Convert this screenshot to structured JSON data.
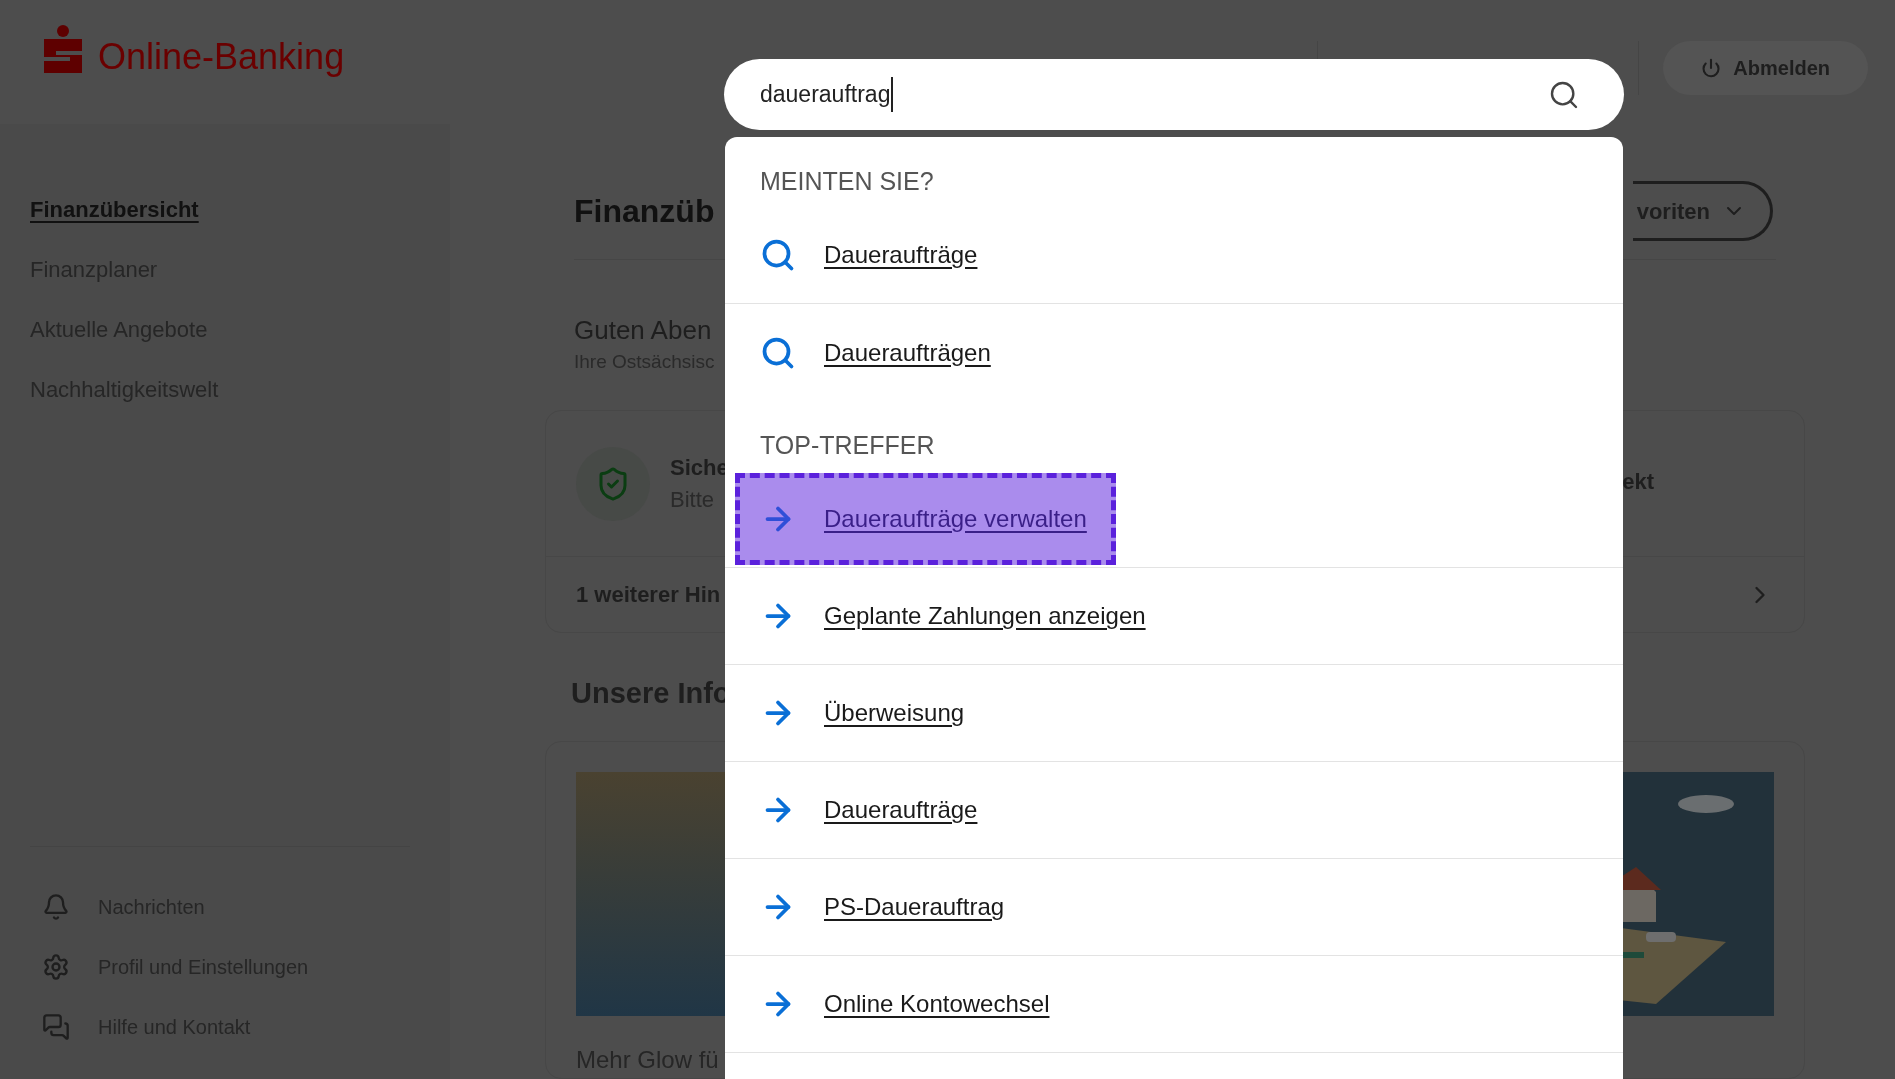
{
  "header": {
    "logo_text": "Online-Banking",
    "logout_button": "Abmelden"
  },
  "sidebar": {
    "items": [
      {
        "label": "Finanzübersicht",
        "selected": true
      },
      {
        "label": "Finanzplaner",
        "selected": false
      },
      {
        "label": "Aktuelle Angebote",
        "selected": false
      },
      {
        "label": "Nachhaltigkeitswelt",
        "selected": false
      }
    ],
    "footer_items": [
      {
        "label": "Nachrichten",
        "kind": "bell"
      },
      {
        "label": "Profil und Einstellungen",
        "kind": "gear"
      },
      {
        "label": "Hilfe und Kontakt",
        "kind": "chat"
      }
    ]
  },
  "main": {
    "title": "Finanzüb",
    "favorites_button": "voriten",
    "greeting": "Guten Aben",
    "greeting_sub": "Ihre Ostsächsisc",
    "notice_card": {
      "title": "Siche",
      "text": "Bitte",
      "right_text": "ekt",
      "footer": "1 weiterer Hin"
    },
    "info_heading": "Unsere Info",
    "info_card": {
      "caption": "Mehr Glow fü"
    }
  },
  "search": {
    "value": "dauerauftrag"
  },
  "dropdown": {
    "sections": [
      {
        "heading": "MEINTEN SIE?",
        "kind": "suggestion",
        "items": [
          {
            "label": "Daueraufträge",
            "selected": false
          },
          {
            "label": "Daueraufträgen",
            "selected": false
          }
        ]
      },
      {
        "heading": "TOP-TREFFER",
        "kind": "result",
        "items": [
          {
            "label": "Daueraufträge verwalten",
            "selected": true
          },
          {
            "label": "Geplante Zahlungen anzeigen",
            "selected": false
          },
          {
            "label": "Überweisung",
            "selected": false
          },
          {
            "label": "Daueraufträge",
            "selected": false
          },
          {
            "label": "PS-Dauerauftrag",
            "selected": false
          },
          {
            "label": "Online Kontowechsel",
            "selected": false
          }
        ]
      }
    ]
  }
}
